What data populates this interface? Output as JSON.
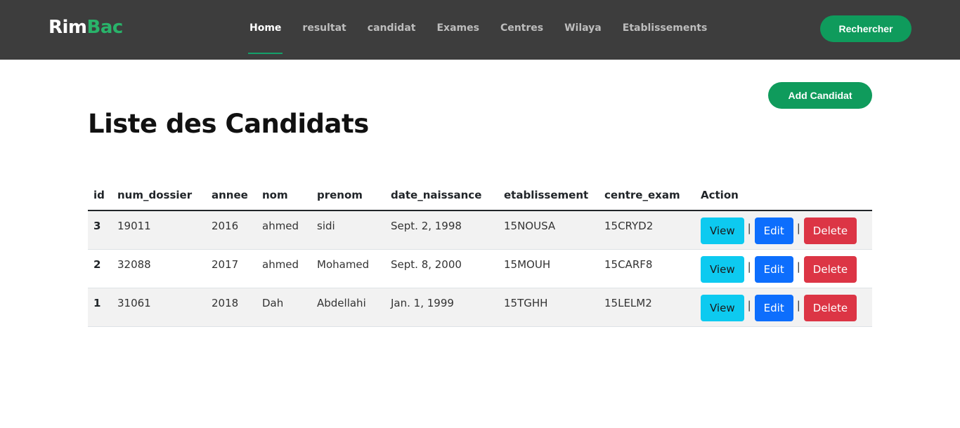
{
  "navbar": {
    "brand_part1": "Rim",
    "brand_part2": "Bac",
    "items": [
      {
        "label": "Home",
        "active": true
      },
      {
        "label": "resultat"
      },
      {
        "label": "candidat"
      },
      {
        "label": "Exames"
      },
      {
        "label": "Centres"
      },
      {
        "label": "Wilaya"
      },
      {
        "label": "Etablissements"
      }
    ],
    "search_label": "Rechercher"
  },
  "main": {
    "add_label": "Add Candidat",
    "title": "Liste des Candidats"
  },
  "table": {
    "headers": [
      "id",
      "num_dossier",
      "annee",
      "nom",
      "prenom",
      "date_naissance",
      "etablissement",
      "centre_exam",
      "Action"
    ],
    "rows": [
      {
        "id": "3",
        "num_dossier": "19011",
        "annee": "2016",
        "nom": "ahmed",
        "prenom": "sidi",
        "date_naissance": "Sept. 2, 1998",
        "etablissement": "15NOUSA",
        "centre_exam": "15CRYD2"
      },
      {
        "id": "2",
        "num_dossier": "32088",
        "annee": "2017",
        "nom": "ahmed",
        "prenom": "Mohamed",
        "date_naissance": "Sept. 8, 2000",
        "etablissement": "15MOUH",
        "centre_exam": "15CARF8"
      },
      {
        "id": "1",
        "num_dossier": "31061",
        "annee": "2018",
        "nom": "Dah",
        "prenom": "Abdellahi",
        "date_naissance": "Jan. 1, 1999",
        "etablissement": "15TGHH",
        "centre_exam": "15LELM2"
      }
    ],
    "actions": {
      "view": "View",
      "edit": "Edit",
      "delete": "Delete",
      "separator": "|"
    }
  },
  "colors": {
    "navbar_bg": "#3d3d3d",
    "brand_accent": "#29b36a",
    "primary_green": "#0f9b5c",
    "view_btn": "#0dcaf0",
    "edit_btn": "#0d6efd",
    "delete_btn": "#dc3545"
  }
}
